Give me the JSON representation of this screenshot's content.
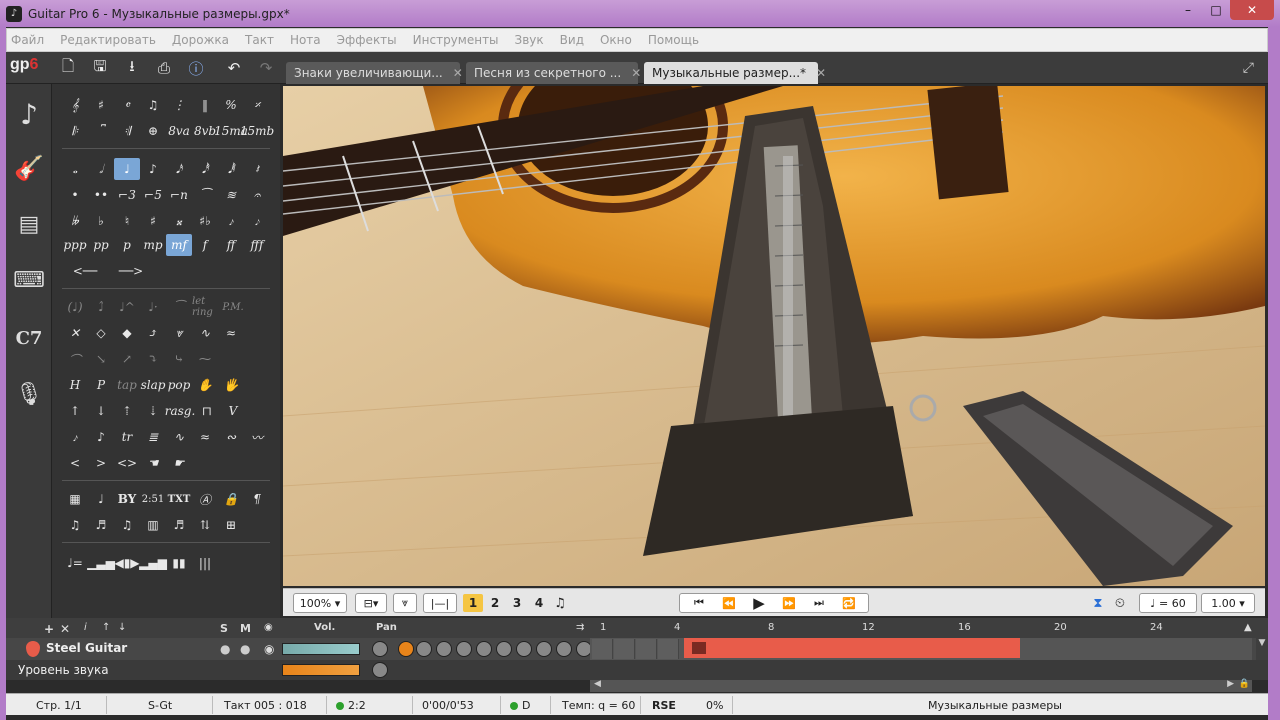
{
  "window": {
    "title": "Guitar Pro 6 - Музыкальные размеры.gpx*",
    "minimize": "–",
    "maximize": "□",
    "close": "✕"
  },
  "menu": [
    "Файл",
    "Редактировать",
    "Дорожка",
    "Такт",
    "Нота",
    "Эффекты",
    "Инструменты",
    "Звук",
    "Вид",
    "Окно",
    "Помощь"
  ],
  "toolbar": {
    "logo": "gp",
    "logo_version": "6"
  },
  "tabs": [
    {
      "label": "Знаки увеличивающи...",
      "active": false
    },
    {
      "label": "Песня из секретного ...",
      "active": false
    },
    {
      "label": "Музыкальные размер...*",
      "active": true
    }
  ],
  "palette": {
    "dynamics": [
      "ppp",
      "pp",
      "p",
      "mp",
      "mf",
      "f",
      "ff",
      "fff"
    ],
    "text_items": [
      "BY",
      "2:51",
      "TXT"
    ],
    "techniques": [
      "tap",
      "slap",
      "pop"
    ],
    "misc": [
      "let ring",
      "P.M.",
      "rasg.",
      "tr",
      "8va",
      "8vb",
      "15ma",
      "15mb"
    ]
  },
  "controls": {
    "zoom": "100%",
    "voices": [
      "1",
      "2",
      "3",
      "4"
    ],
    "tempo": "= 60",
    "speed": "1.00"
  },
  "tracks_header": {
    "vol": "Vol.",
    "pan": "Pan",
    "solo": "S",
    "mute": "M",
    "markers": [
      "1",
      "4",
      "8",
      "12",
      "16",
      "20",
      "24"
    ]
  },
  "tracks": [
    {
      "name": "Steel Guitar",
      "color": "#e85c4a"
    }
  ],
  "master_track": {
    "name": "Уровень звука"
  },
  "status": {
    "page": "Стр. 1/1",
    "track": "S-Gt",
    "bar": "Такт 005 : 018",
    "signature": "2:2",
    "time": "0'00/0'53",
    "key": "D",
    "tempo": "Темп: q = 60",
    "engine": "RSE",
    "volume": "0%",
    "file": "Музыкальные размеры"
  }
}
